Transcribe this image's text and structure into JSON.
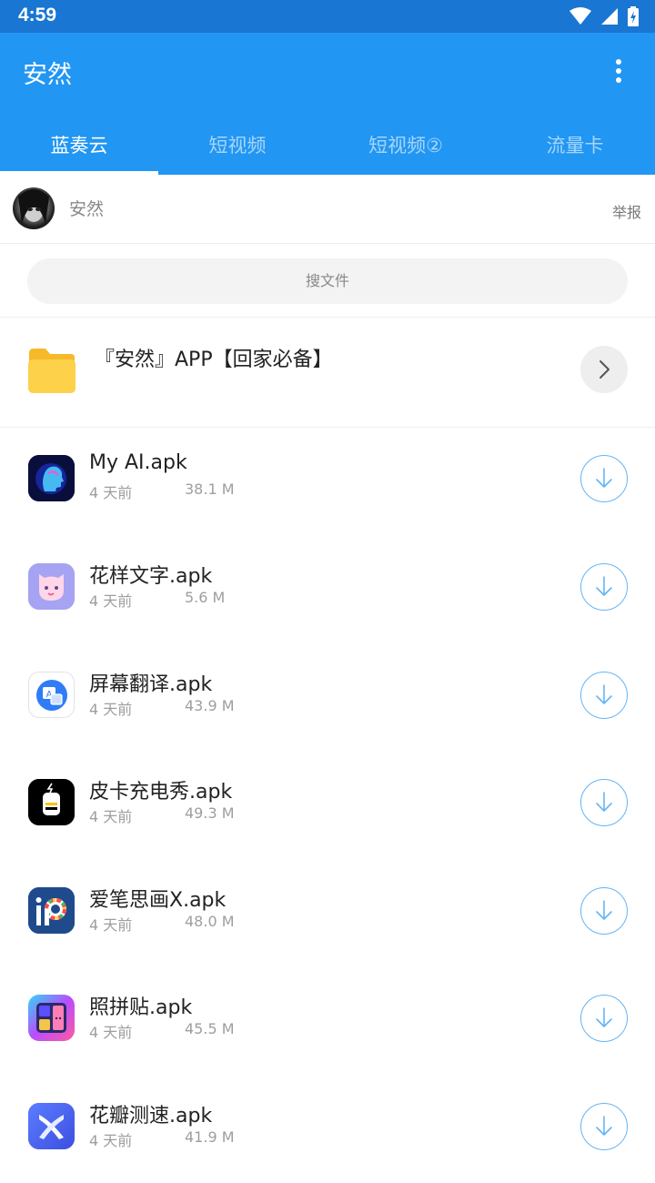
{
  "status_bar": {
    "time": "4:59"
  },
  "app_bar": {
    "title": "安然"
  },
  "tabs": [
    {
      "label": "蓝奏云",
      "active": true
    },
    {
      "label": "短视频",
      "active": false
    },
    {
      "label": "短视频②",
      "active": false
    },
    {
      "label": "流量卡",
      "active": false
    }
  ],
  "profile": {
    "name": "安然",
    "report_label": "举报"
  },
  "search": {
    "placeholder": "搜文件"
  },
  "folder": {
    "name": "『安然』APP【回家必备】"
  },
  "files": [
    {
      "name": "My AI.apk",
      "age": "4 天前",
      "size": "38.1 M",
      "icon": "my-ai-app-icon"
    },
    {
      "name": "花样文字.apk",
      "age": "4 天前",
      "size": "5.6 M",
      "icon": "huayang-wenzi-app-icon"
    },
    {
      "name": "屏幕翻译.apk",
      "age": "4 天前",
      "size": "43.9 M",
      "icon": "screen-translate-app-icon"
    },
    {
      "name": "皮卡充电秀.apk",
      "age": "4 天前",
      "size": "49.3 M",
      "icon": "pika-charging-app-icon"
    },
    {
      "name": "爱笔思画X.apk",
      "age": "4 天前",
      "size": "48.0 M",
      "icon": "ibis-paint-app-icon"
    },
    {
      "name": "照拼贴.apk",
      "age": "4 天前",
      "size": "45.5 M",
      "icon": "photo-collage-app-icon"
    },
    {
      "name": "花瓣测速.apk",
      "age": "4 天前",
      "size": "41.9 M",
      "icon": "petal-speedtest-app-icon"
    }
  ],
  "colors": {
    "status_bar": "#1976d2",
    "app_bar": "#2196f3",
    "download_accent": "#64b5f6"
  }
}
